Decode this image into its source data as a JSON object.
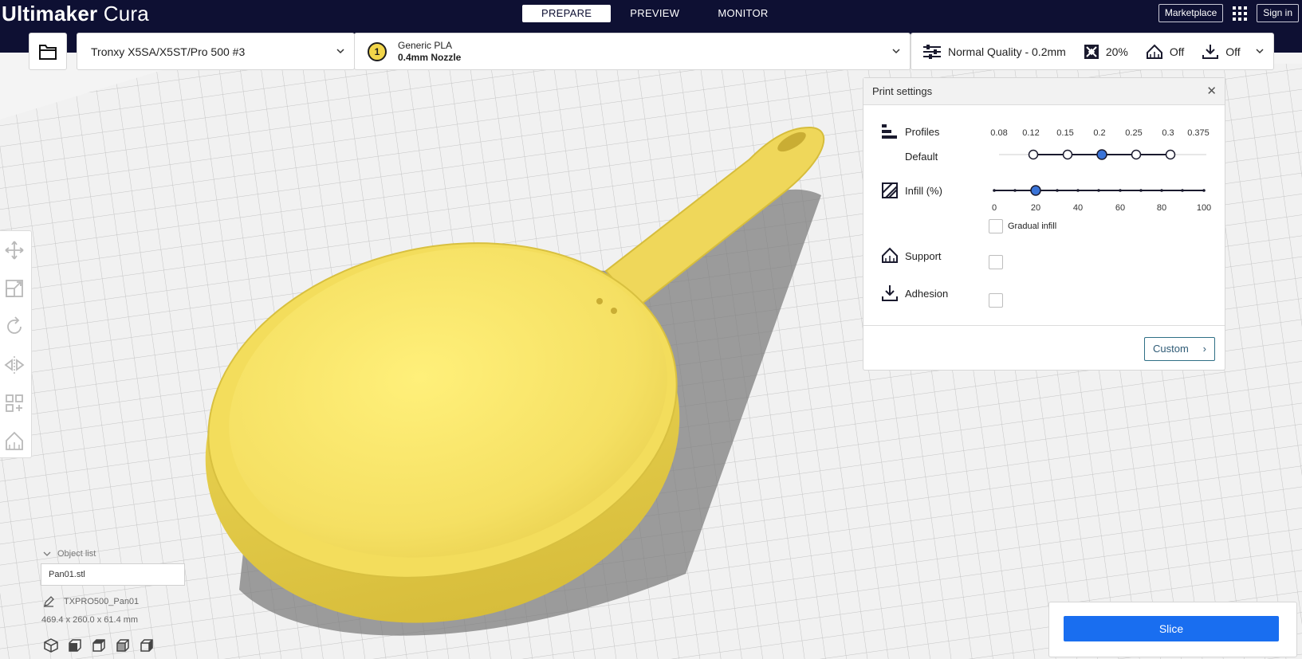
{
  "app": {
    "logo_bold": "Ultimaker",
    "logo_light": "Cura"
  },
  "stages": [
    {
      "label": "PREPARE",
      "active": true
    },
    {
      "label": "PREVIEW",
      "active": false
    },
    {
      "label": "MONITOR",
      "active": false
    }
  ],
  "top_right": {
    "marketplace": "Marketplace",
    "sign_in": "Sign in",
    "apps_icon": "grid-icon"
  },
  "printer": {
    "name": "Tronxy X5SA/X5ST/Pro 500 #3"
  },
  "material": {
    "extruder": "1",
    "name": "Generic PLA",
    "nozzle": "0.4mm Nozzle",
    "color": "#f2d64a"
  },
  "settings_summary": {
    "quality": "Normal Quality - 0.2mm",
    "infill": "20%",
    "support": "Off",
    "adhesion": "Off"
  },
  "print_settings": {
    "title": "Print settings",
    "profiles_label": "Profiles",
    "profile_default": "Default",
    "layer_heights": [
      "0.08",
      "0.12",
      "0.15",
      "0.2",
      "0.25",
      "0.3",
      "0.375"
    ],
    "selected_layer_height": "0.2",
    "infill_label": "Infill (%)",
    "infill_ticks": [
      "0",
      "20",
      "40",
      "60",
      "80",
      "100"
    ],
    "infill_value": 20,
    "gradual_infill_label": "Gradual infill",
    "gradual_infill": false,
    "support_label": "Support",
    "support": false,
    "adhesion_label": "Adhesion",
    "adhesion": false,
    "custom_button": "Custom"
  },
  "object_list": {
    "toggle_label": "Object list",
    "file_name": "Pan01.stl",
    "object_name": "TXPRO500_Pan01",
    "dimensions": "469.4 x 260.0 x 61.4 mm"
  },
  "slice": {
    "button_label": "Slice"
  },
  "colors": {
    "topbar": "#0e1033",
    "accent": "#196ef0",
    "model": "#f7e46a",
    "slider_handle": "#3a74d8"
  }
}
